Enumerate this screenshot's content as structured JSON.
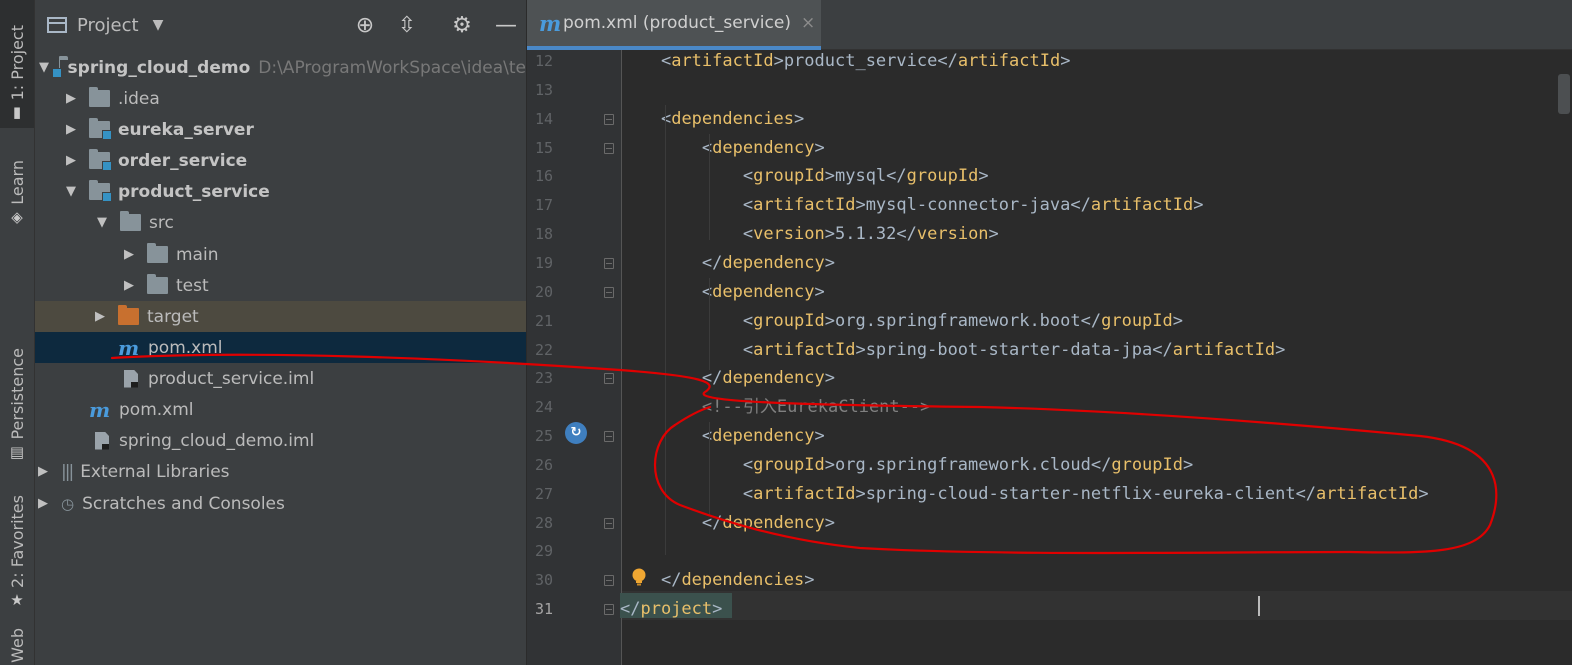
{
  "tool_strip": {
    "tabs": [
      {
        "label": "1: Project",
        "icon": "folder-icon",
        "active": true
      },
      {
        "label": "Learn",
        "icon": "graduation-cap-icon"
      },
      {
        "label": "Persistence",
        "icon": "database-icon"
      },
      {
        "label": "2: Favorites",
        "icon": "star-icon"
      },
      {
        "label": "Web",
        "icon": "web-icon"
      }
    ]
  },
  "project_panel": {
    "title": "Project",
    "dropdown_icon": "chevron-down-icon",
    "header_buttons": [
      "locate-icon",
      "collapse-all-icon",
      "gear-icon",
      "hide-icon"
    ],
    "tree": [
      {
        "label": "spring_cloud_demo",
        "path": "D:\\AProgramWorkSpace\\idea\\te",
        "icon": "module-folder-icon",
        "expanded": true
      },
      {
        "label": ".idea",
        "icon": "folder-icon",
        "expanded": false
      },
      {
        "label": "eureka_server",
        "icon": "module-folder-icon",
        "expanded": false
      },
      {
        "label": "order_service",
        "icon": "module-folder-icon",
        "expanded": false
      },
      {
        "label": "product_service",
        "icon": "module-folder-icon",
        "expanded": true
      },
      {
        "label": "src",
        "icon": "folder-icon",
        "expanded": true
      },
      {
        "label": "main",
        "icon": "folder-icon",
        "expanded": false
      },
      {
        "label": "test",
        "icon": "folder-icon",
        "expanded": false
      },
      {
        "label": "target",
        "icon": "excluded-folder-icon",
        "expanded": false
      },
      {
        "label": "pom.xml",
        "icon": "maven-icon",
        "selected": true
      },
      {
        "label": "product_service.iml",
        "icon": "iml-file-icon"
      },
      {
        "label": "pom.xml",
        "icon": "maven-icon"
      },
      {
        "label": "spring_cloud_demo.iml",
        "icon": "iml-file-icon"
      },
      {
        "label": "External Libraries",
        "icon": "library-icon",
        "expanded": false
      },
      {
        "label": "Scratches and Consoles",
        "icon": "scratches-icon",
        "expanded": false
      }
    ]
  },
  "editor": {
    "tab": {
      "icon_letter": "m",
      "label": "pom.xml (product_service)",
      "close": "×"
    },
    "lines": [
      {
        "n": "12",
        "text": "    <artifactId>product_service</artifactId>"
      },
      {
        "n": "13",
        "text": ""
      },
      {
        "n": "14",
        "text": "    <dependencies>"
      },
      {
        "n": "15",
        "text": "        <dependency>"
      },
      {
        "n": "16",
        "text": "            <groupId>mysql</groupId>"
      },
      {
        "n": "17",
        "text": "            <artifactId>mysql-connector-java</artifactId>"
      },
      {
        "n": "18",
        "text": "            <version>5.1.32</version>"
      },
      {
        "n": "19",
        "text": "        </dependency>"
      },
      {
        "n": "20",
        "text": "        <dependency>"
      },
      {
        "n": "21",
        "text": "            <groupId>org.springframework.boot</groupId>"
      },
      {
        "n": "22",
        "text": "            <artifactId>spring-boot-starter-data-jpa</artifactId>"
      },
      {
        "n": "23",
        "text": "        </dependency>"
      },
      {
        "n": "24",
        "text": "        <!--引入EurekaClient-->"
      },
      {
        "n": "25",
        "text": "        <dependency>"
      },
      {
        "n": "26",
        "text": "            <groupId>org.springframework.cloud</groupId>"
      },
      {
        "n": "27",
        "text": "            <artifactId>spring-cloud-starter-netflix-eureka-client</artifactId>"
      },
      {
        "n": "28",
        "text": "        </dependency>"
      },
      {
        "n": "29",
        "text": ""
      },
      {
        "n": "30",
        "text": "    </dependencies>"
      },
      {
        "n": "31",
        "text": "</project>"
      }
    ],
    "current_line": "31",
    "gutter_marker_icon": "maven-dependency-icon",
    "intention_icon": "lightbulb-icon"
  },
  "colors": {
    "tag": "#e8bf6a",
    "text": "#a9b7c6",
    "comment": "#808080",
    "annotation": "#e00000",
    "accent": "#4a88c7"
  }
}
